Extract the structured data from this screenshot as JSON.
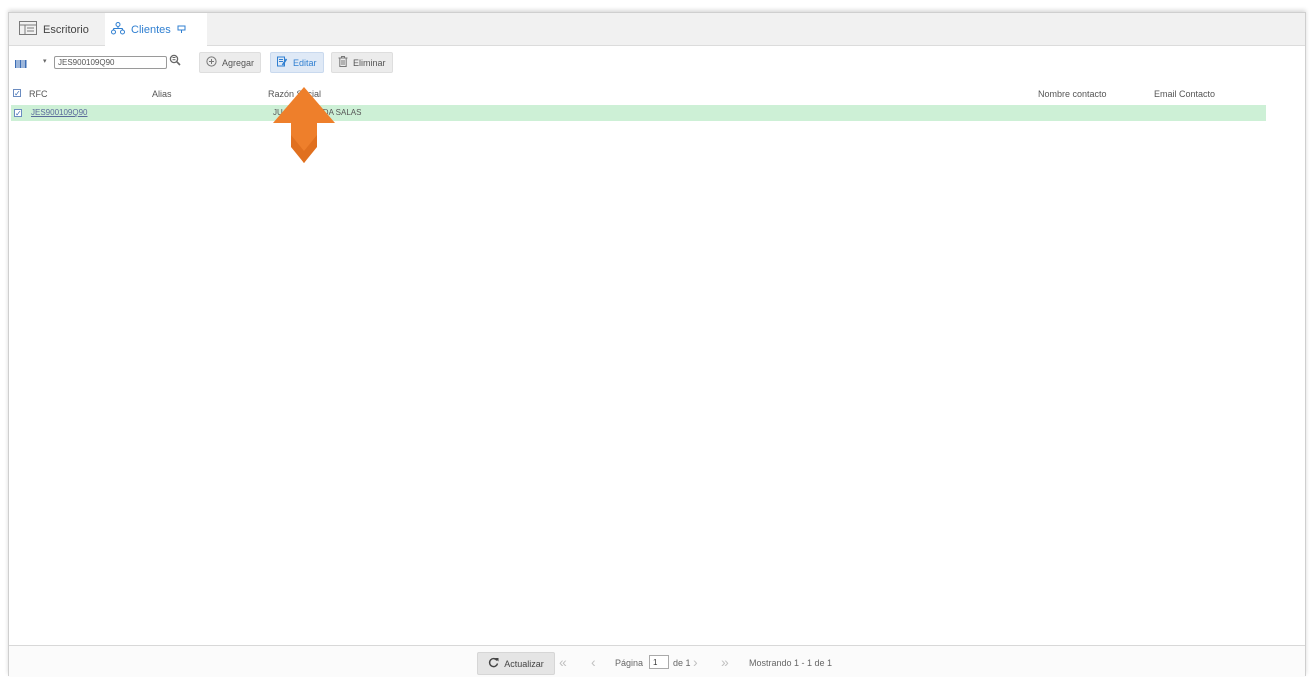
{
  "tabs": [
    {
      "label": "Escritorio",
      "icon": "desktop-icon"
    },
    {
      "label": "Clientes",
      "icon": "network-icon",
      "pin": "pin-icon"
    }
  ],
  "toolbar": {
    "search_value": "JES900109Q90",
    "buttons": {
      "add": "Agregar",
      "edit": "Editar",
      "delete": "Eliminar"
    }
  },
  "table": {
    "columns": {
      "rfc": "RFC",
      "alias": "Alias",
      "razon_social": "Razón Social",
      "nombre_contacto": "Nombre contacto",
      "email_contacto": "Email Contacto"
    },
    "rows": [
      {
        "rfc": "JES900109Q90",
        "razon_social": "JUAN ESTRADA SALAS",
        "selected": true
      }
    ]
  },
  "footer": {
    "refresh": "Actualizar",
    "page_label": "Página",
    "page_value": "1",
    "page_of": "de 1",
    "showing": "Mostrando 1 - 1 de 1"
  },
  "colors": {
    "accent": "#2f7fd1",
    "selected_row": "#cdf0d6",
    "arrow": "#ee7f2b"
  }
}
